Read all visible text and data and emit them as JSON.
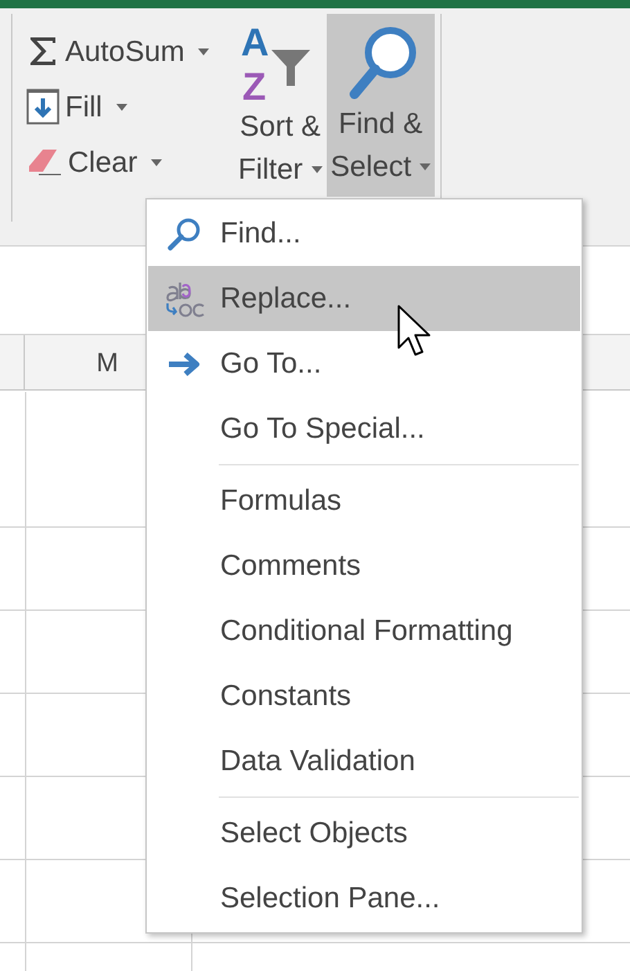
{
  "ribbon": {
    "small_buttons": [
      {
        "label": "AutoSum",
        "kind": "sigma"
      },
      {
        "label": "Fill",
        "kind": "fill"
      },
      {
        "label": "Clear",
        "kind": "eraser"
      }
    ],
    "large_buttons": [
      {
        "line1": "Sort &",
        "line2": "Filter",
        "kind": "sort",
        "icon_letters": [
          "A",
          "Z"
        ],
        "selected": false
      },
      {
        "line1": "Find &",
        "line2": "Select",
        "kind": "search",
        "selected": true
      }
    ]
  },
  "sheet": {
    "column_header": "M"
  },
  "menu": {
    "items": [
      {
        "label": "Find...",
        "kind": "search",
        "selected": false,
        "separator_before": false
      },
      {
        "label": "Replace...",
        "kind": "replace",
        "selected": true,
        "separator_before": false
      },
      {
        "label": "Go To...",
        "kind": "arrow",
        "selected": false,
        "separator_before": false
      },
      {
        "label": "Go To Special...",
        "kind": "plain",
        "selected": false,
        "separator_before": false
      },
      {
        "label": "Formulas",
        "kind": "plain",
        "selected": false,
        "separator_before": true
      },
      {
        "label": "Comments",
        "kind": "plain",
        "selected": false,
        "separator_before": false
      },
      {
        "label": "Conditional Formatting",
        "kind": "plain",
        "selected": false,
        "separator_before": false
      },
      {
        "label": "Constants",
        "kind": "plain",
        "selected": false,
        "separator_before": false
      },
      {
        "label": "Data Validation",
        "kind": "plain",
        "selected": false,
        "separator_before": false
      },
      {
        "label": "Select Objects",
        "kind": "plain",
        "selected": false,
        "separator_before": true
      },
      {
        "label": "Selection Pane...",
        "kind": "plain",
        "selected": false,
        "separator_before": false
      }
    ]
  }
}
